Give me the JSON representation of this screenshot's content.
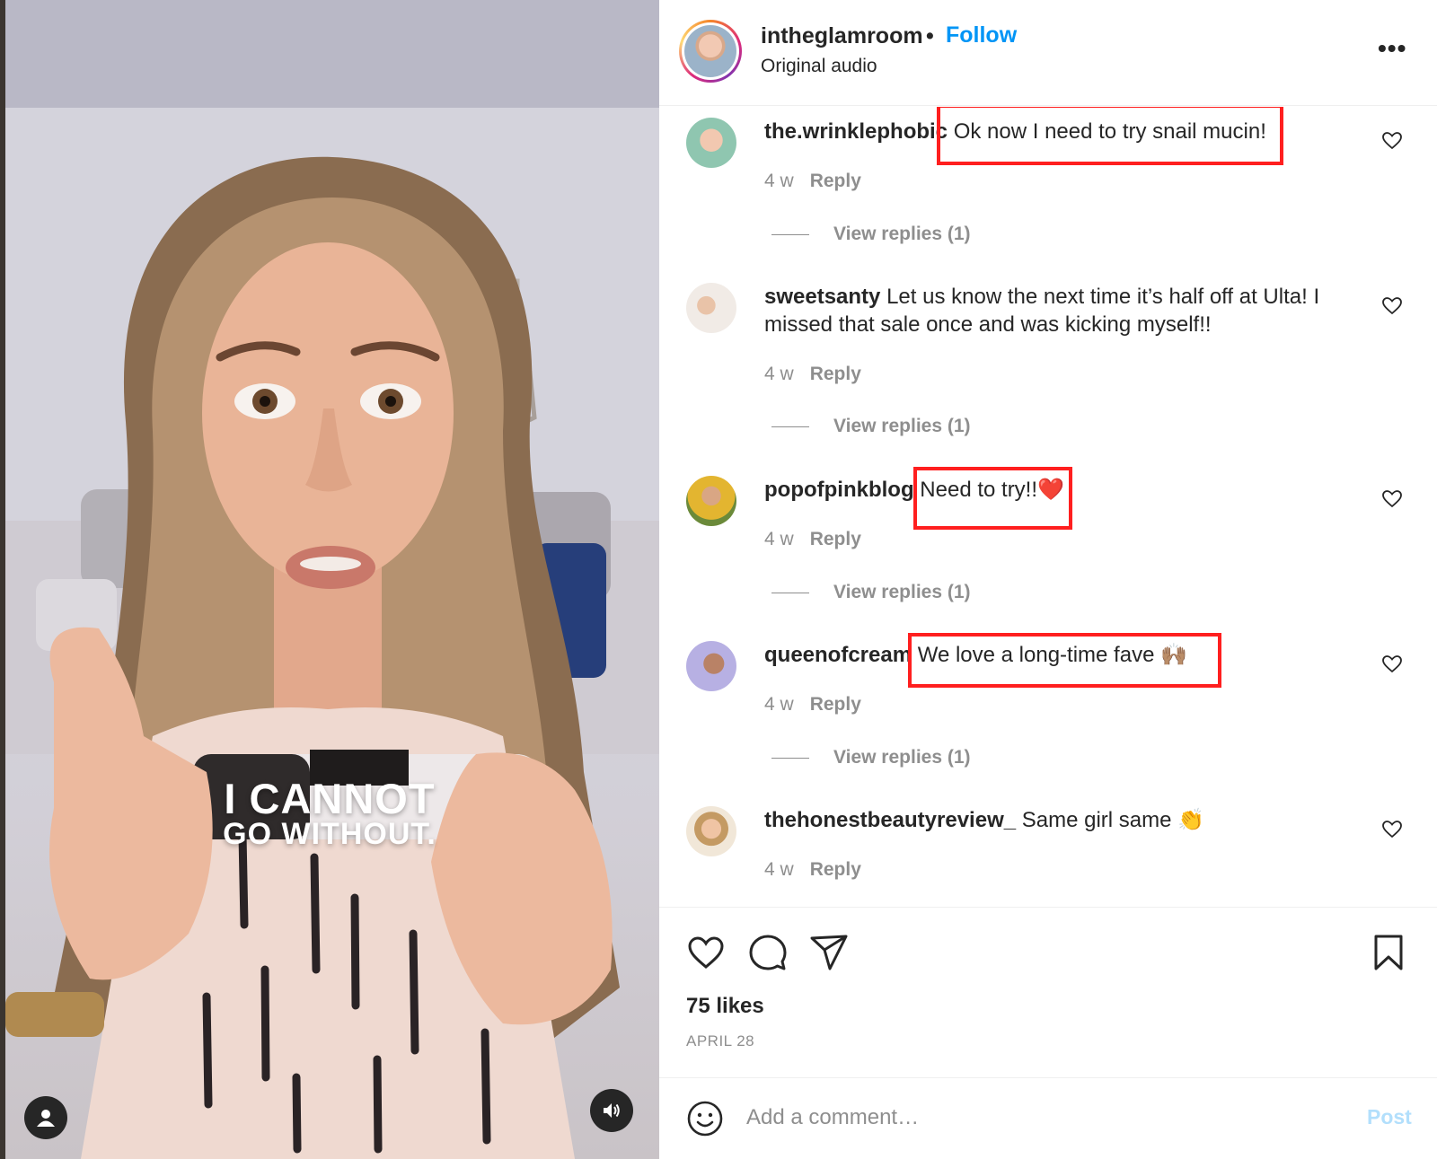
{
  "video": {
    "caption_line1": "I CANNOT",
    "caption_line2": "GO WITHOUT.",
    "user_icon": "person-icon",
    "sound_icon": "speaker-icon"
  },
  "header": {
    "username": "intheglamroom",
    "separator": "•",
    "follow_label": "Follow",
    "audio_label": "Original audio",
    "more_label": "•••"
  },
  "comments": [
    {
      "username": "the.wrinklephobic",
      "text": "Ok now I need to try snail mucin!",
      "age": "4 w",
      "reply_label": "Reply",
      "view_replies": "View replies (1)"
    },
    {
      "username": "sweetsanty",
      "text": "Let us know the next time it’s half off at Ulta! I missed that sale once and was kicking myself!!",
      "age": "4 w",
      "reply_label": "Reply",
      "view_replies": "View replies (1)"
    },
    {
      "username": "popofpinkblog",
      "text": "Need to try!!❤️",
      "age": "4 w",
      "reply_label": "Reply",
      "view_replies": "View replies (1)"
    },
    {
      "username": "queenofcream",
      "text": "We love a long-time fave 🙌🏽",
      "age": "4 w",
      "reply_label": "Reply",
      "view_replies": "View replies (1)"
    },
    {
      "username": "thehonestbeautyreview_",
      "text": "Same girl same 👏",
      "age": "4 w",
      "reply_label": "Reply"
    }
  ],
  "actions": {
    "icons": [
      "heart-icon",
      "comment-icon",
      "share-icon",
      "bookmark-icon"
    ],
    "likes": "75 likes",
    "date": "APRIL 28"
  },
  "add_comment": {
    "placeholder": "Add a comment…",
    "post_label": "Post"
  },
  "colors": {
    "follow": "#0095f6",
    "highlight_box": "#ff1f1f",
    "post_disabled": "#b2dffc",
    "muted_text": "#8e8e8e"
  }
}
